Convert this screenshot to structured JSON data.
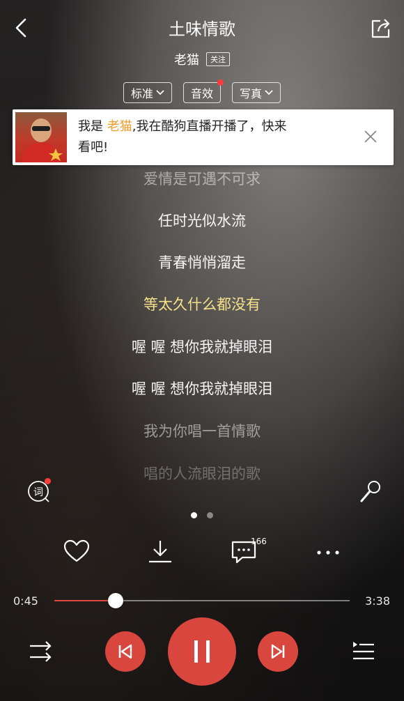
{
  "header": {
    "title": "土味情歌",
    "artist": "老猫",
    "follow_label": "关注"
  },
  "options": [
    {
      "label": "标准",
      "has_dropdown": true,
      "has_badge": false
    },
    {
      "label": "音效",
      "has_dropdown": false,
      "has_badge": true
    },
    {
      "label": "写真",
      "has_dropdown": true,
      "has_badge": false
    }
  ],
  "notification": {
    "prefix": "我是",
    "name": "老猫",
    "message_line1": ",我在酷狗直播开播了，快来",
    "message_line2": "看吧!"
  },
  "lyrics": [
    {
      "text": "爱情是可遇不可求",
      "state": "past-faded"
    },
    {
      "text": "任时光似水流",
      "state": "normal"
    },
    {
      "text": "青春悄悄溜走",
      "state": "normal"
    },
    {
      "text": "等太久什么都没有",
      "state": "current"
    },
    {
      "text": "喔 喔 想你我就掉眼泪",
      "state": "normal"
    },
    {
      "text": "喔 喔 想你我就掉眼泪",
      "state": "normal"
    },
    {
      "text": "我为你唱一首情歌",
      "state": "faded"
    },
    {
      "text": "唱的人流眼泪的歌",
      "state": "more-faded"
    }
  ],
  "lyric_button_label": "词",
  "page_dots": {
    "count": 2,
    "active_index": 0
  },
  "actions": {
    "comment_count": "166"
  },
  "player": {
    "current_time": "0:45",
    "total_time": "3:38",
    "progress": 0.207
  },
  "colors": {
    "accent": "#d8463d",
    "current_lyric": "#f6e28a",
    "notification_name": "#f39b2b"
  },
  "icons": [
    "back-icon",
    "share-icon",
    "close-icon",
    "lyric-icon",
    "mic-icon",
    "heart-icon",
    "download-icon",
    "comment-icon",
    "more-icon",
    "shuffle-icon",
    "prev-icon",
    "pause-icon",
    "next-icon",
    "playlist-icon"
  ]
}
